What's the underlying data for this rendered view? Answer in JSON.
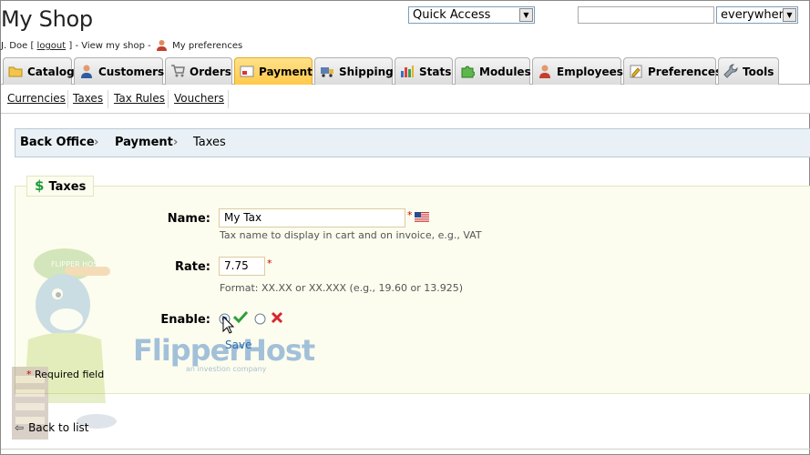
{
  "header": {
    "shop_title": "My Shop",
    "user": "J. Doe [",
    "logout": "logout",
    "after_logout": "] - View my shop -",
    "preferences": "My preferences",
    "quick_access": "Quick Access",
    "search_value": "",
    "search_scope": "everywhere"
  },
  "tabs": [
    {
      "label": "Catalog",
      "icon": "folder-icon"
    },
    {
      "label": "Customers",
      "icon": "customer-icon"
    },
    {
      "label": "Orders",
      "icon": "cart-icon"
    },
    {
      "label": "Payment",
      "icon": "payment-icon",
      "active": true
    },
    {
      "label": "Shipping",
      "icon": "truck-icon"
    },
    {
      "label": "Stats",
      "icon": "chart-icon"
    },
    {
      "label": "Modules",
      "icon": "puzzle-icon"
    },
    {
      "label": "Employees",
      "icon": "employee-icon"
    },
    {
      "label": "Preferences",
      "icon": "preferences-icon"
    },
    {
      "label": "Tools",
      "icon": "wrench-icon"
    }
  ],
  "subnav": [
    "Currencies",
    "Taxes",
    "Tax Rules",
    "Vouchers"
  ],
  "breadcrumb": [
    "Back Office",
    "Payment",
    "Taxes"
  ],
  "form": {
    "legend": "Taxes",
    "name_label": "Name:",
    "name_value": "My Tax",
    "name_hint": "Tax name to display in cart and on invoice, e.g., VAT",
    "rate_label": "Rate:",
    "rate_value": "7.75",
    "rate_hint": "Format: XX.XX or XX.XXX (e.g., 19.60 or 13.925)",
    "enable_label": "Enable:",
    "enable_selected": "yes",
    "save": "Save",
    "required_star": "*",
    "required_note": "Required field"
  },
  "watermark": {
    "brand": "FlipperHost",
    "tagline": "an investion company",
    "cap_text": "FLIPPER HOST"
  },
  "back_link": "Back to list",
  "colors": {
    "active_tab": "#ffc94a",
    "breadcrumb_bg": "#e9f1f6",
    "form_bg": "#fcfdee",
    "required": "#d10000"
  }
}
